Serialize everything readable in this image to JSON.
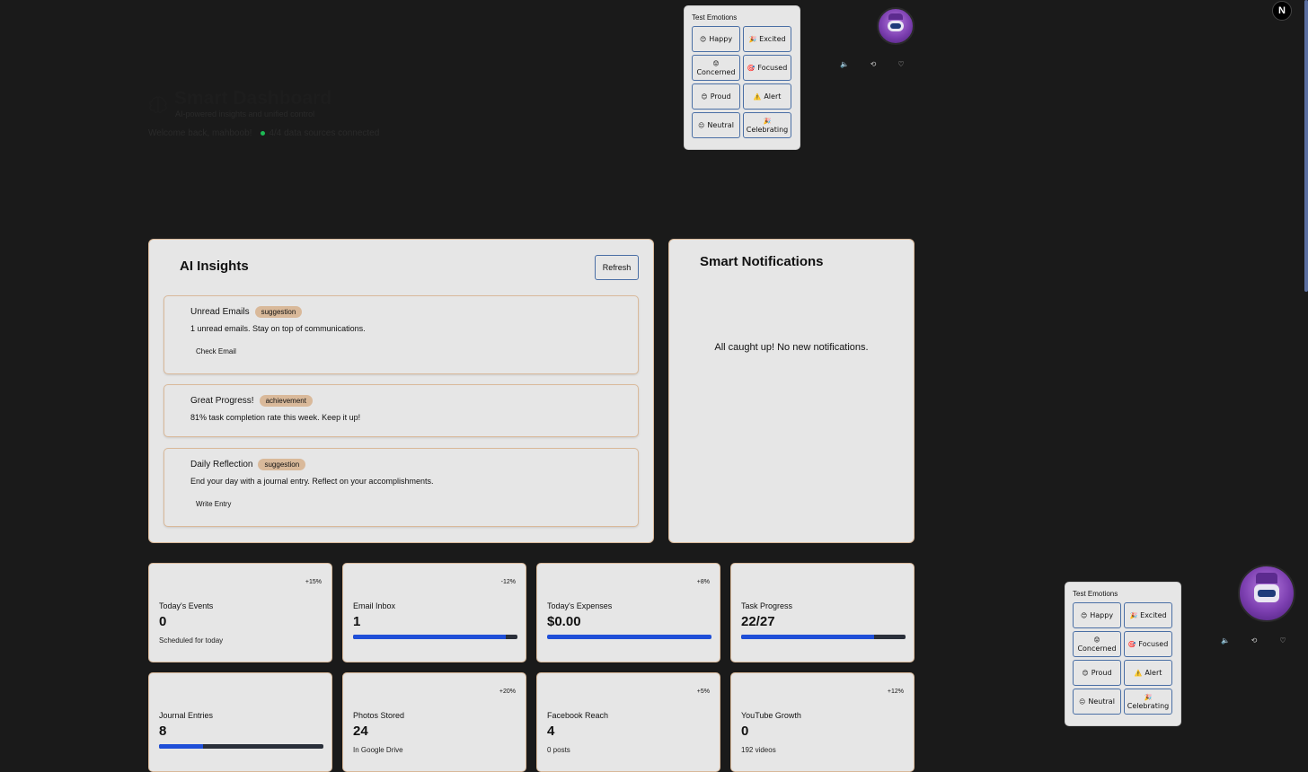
{
  "header": {
    "title": "Smart Dashboard",
    "subtitle": "AI-powered insights and unified control",
    "welcome": "Welcome back, mahboob!",
    "sources": "4/4 data sources connected"
  },
  "emotion_panel": {
    "title": "Test Emotions",
    "buttons": [
      {
        "icon": "😊",
        "label": "Happy"
      },
      {
        "icon": "🎉",
        "label": "Excited"
      },
      {
        "icon": "😟",
        "label": "Concerned"
      },
      {
        "icon": "🎯",
        "label": "Focused"
      },
      {
        "icon": "😊",
        "label": "Proud"
      },
      {
        "icon": "⚠️",
        "label": "Alert"
      },
      {
        "icon": "😐",
        "label": "Neutral"
      },
      {
        "icon": "🎉",
        "label": "Celebrating"
      }
    ],
    "controls": [
      "volume-icon",
      "history-icon",
      "heart-icon"
    ]
  },
  "ai_insights": {
    "title": "AI Insights",
    "refresh_label": "Refresh",
    "items": [
      {
        "title": "Unread Emails",
        "tag": "suggestion",
        "desc": "1 unread emails. Stay on top of communications.",
        "action": "Check Email"
      },
      {
        "title": "Great Progress!",
        "tag": "achievement",
        "desc": "81% task completion rate this week. Keep it up!",
        "action": ""
      },
      {
        "title": "Daily Reflection",
        "tag": "suggestion",
        "desc": "End your day with a journal entry. Reflect on your accomplishments.",
        "action": "Write Entry"
      }
    ]
  },
  "notifications": {
    "title": "Smart Notifications",
    "empty": "All caught up! No new notifications."
  },
  "stats": [
    {
      "label": "Today's Events",
      "value": "0",
      "change": "+15%",
      "sub": "Scheduled for today",
      "progress": null
    },
    {
      "label": "Email Inbox",
      "value": "1",
      "change": "-12%",
      "sub": "",
      "progress": 0.93
    },
    {
      "label": "Today's Expenses",
      "value": "$0.00",
      "change": "+8%",
      "sub": "",
      "progress": 1.0
    },
    {
      "label": "Task Progress",
      "value": "22/27",
      "change": "",
      "sub": "",
      "progress": 0.81
    },
    {
      "label": "Journal Entries",
      "value": "8",
      "change": "",
      "sub": "",
      "progress": 0.27
    },
    {
      "label": "Photos Stored",
      "value": "24",
      "change": "+20%",
      "sub": "In Google Drive",
      "progress": null
    },
    {
      "label": "Facebook Reach",
      "value": "4",
      "change": "+5%",
      "sub": "0 posts",
      "progress": null
    },
    {
      "label": "YouTube Growth",
      "value": "0",
      "change": "+12%",
      "sub": "192 videos",
      "progress": null
    }
  ],
  "nextjs_badge": "N",
  "colors": {
    "accent": "#1f4fd8",
    "card_border": "#d9b99a",
    "tag_bg": "#d9b99a",
    "background": "#1a1a1a",
    "card_bg": "#e6e6e6"
  }
}
